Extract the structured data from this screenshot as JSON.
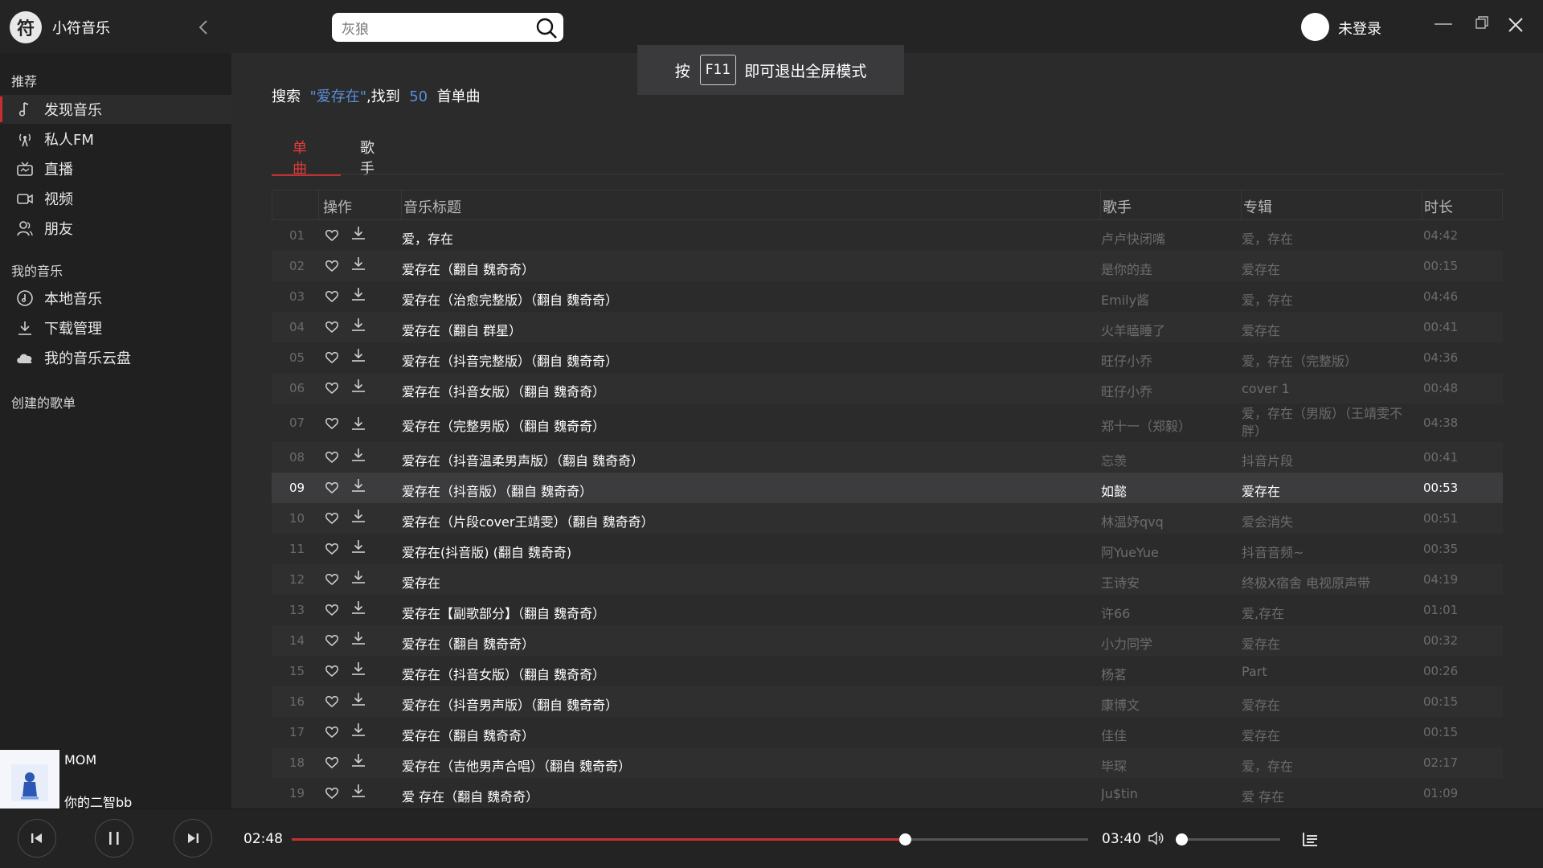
{
  "app": {
    "logo_glyph": "符",
    "title": "小符音乐",
    "search_value": "灰狼",
    "login_text": "未登录"
  },
  "fullscreen_hint": {
    "prefix": "按",
    "key": "F11",
    "suffix": "即可退出全屏模式"
  },
  "sidebar": {
    "group_recommend": "推荐",
    "recommend_items": [
      {
        "label": "发现音乐",
        "icon": "music-note-icon"
      },
      {
        "label": "私人FM",
        "icon": "radio-icon"
      },
      {
        "label": "直播",
        "icon": "live-tv-icon"
      },
      {
        "label": "视频",
        "icon": "video-icon"
      },
      {
        "label": "朋友",
        "icon": "friends-icon"
      }
    ],
    "group_my_music": "我的音乐",
    "my_music_items": [
      {
        "label": "本地音乐",
        "icon": "disc-icon"
      },
      {
        "label": "下载管理",
        "icon": "download-icon"
      },
      {
        "label": "我的音乐云盘",
        "icon": "cloud-icon"
      }
    ],
    "group_playlists": "创建的歌单"
  },
  "now_playing": {
    "title": "MOM",
    "artist": "你的二智bb"
  },
  "search_result": {
    "prefix": "搜索",
    "keyword": "\"爱存在\"",
    "middle": ",找到",
    "count": "50",
    "suffix": "首单曲"
  },
  "tabs": [
    "单曲",
    "歌手"
  ],
  "table": {
    "headers": [
      "操作",
      "音乐标题",
      "歌手",
      "专辑",
      "时长"
    ],
    "rows": [
      {
        "num": "01",
        "title": "爱，存在",
        "artist": "卢卢快闭嘴",
        "album": "爱，存在",
        "duration": "04:42"
      },
      {
        "num": "02",
        "title": "爱存在（翻自 魏奇奇）",
        "artist": "是你的垚",
        "album": "爱存在",
        "duration": "00:15"
      },
      {
        "num": "03",
        "title": "爱存在（治愈完整版）（翻自 魏奇奇）",
        "artist": "Emily酱",
        "album": "爱，存在",
        "duration": "04:46"
      },
      {
        "num": "04",
        "title": "爱存在（翻自 群星）",
        "artist": "火羊瞌睡了",
        "album": "爱存在",
        "duration": "00:41"
      },
      {
        "num": "05",
        "title": "爱存在（抖音完整版）（翻自 魏奇奇）",
        "artist": "旺仔小乔",
        "album": "爱，存在（完整版）",
        "duration": "04:36"
      },
      {
        "num": "06",
        "title": "爱存在（抖音女版）（翻自 魏奇奇）",
        "artist": "旺仔小乔",
        "album": "cover 1",
        "duration": "00:48"
      },
      {
        "num": "07",
        "title": "爱存在（完整男版）（翻自 魏奇奇）",
        "artist": "郑十一（郑毅）",
        "album": "爱，存在（男版）（王靖雯不胖）",
        "duration": "04:38"
      },
      {
        "num": "08",
        "title": "爱存在（抖音温柔男声版）（翻自 魏奇奇）",
        "artist": "忘羡",
        "album": "抖音片段",
        "duration": "00:41"
      },
      {
        "num": "09",
        "title": "爱存在（抖音版）（翻自 魏奇奇）",
        "artist": "如懿",
        "album": "爱存在",
        "duration": "00:53"
      },
      {
        "num": "10",
        "title": "爱存在（片段cover王靖雯）（翻自 魏奇奇）",
        "artist": "林温妤qvq",
        "album": "爱会消失",
        "duration": "00:51"
      },
      {
        "num": "11",
        "title": "爱存在(抖音版) (翻自 魏奇奇)",
        "artist": "阿YueYue",
        "album": "抖音音频~",
        "duration": "00:35"
      },
      {
        "num": "12",
        "title": "爱存在",
        "artist": "王诗安",
        "album": "终极X宿舍 电视原声带",
        "duration": "04:19"
      },
      {
        "num": "13",
        "title": "爱存在【副歌部分】（翻自 魏奇奇）",
        "artist": "许66",
        "album": "爱,存在",
        "duration": "01:01"
      },
      {
        "num": "14",
        "title": "爱存在（翻自 魏奇奇）",
        "artist": "小力同学",
        "album": "爱存在",
        "duration": "00:32"
      },
      {
        "num": "15",
        "title": "爱存在（抖音女版）（翻自 魏奇奇）",
        "artist": "杨茗",
        "album": "Part",
        "duration": "00:26"
      },
      {
        "num": "16",
        "title": "爱存在（抖音男声版）（翻自 魏奇奇）",
        "artist": "康博文",
        "album": "爱存在",
        "duration": "00:15"
      },
      {
        "num": "17",
        "title": "爱存在（翻自 魏奇奇）",
        "artist": "佳佳",
        "album": "爱存在",
        "duration": "00:15"
      },
      {
        "num": "18",
        "title": "爱存在（吉他男声合唱）（翻自 魏奇奇）",
        "artist": "毕琛",
        "album": "爱，存在",
        "duration": "02:17"
      },
      {
        "num": "19",
        "title": "爱 存在（翻自 魏奇奇）",
        "artist": "Ju$tin",
        "album": "爱 存在",
        "duration": "01:09"
      }
    ]
  },
  "player": {
    "current_time": "02:48",
    "total_time": "03:40",
    "progress": 0.77,
    "volume": 0.02
  },
  "colors": {
    "accent": "#c62f2f",
    "highlight": "#5a8ed8",
    "background": "#2b2b2b",
    "sidebar": "#202020"
  }
}
